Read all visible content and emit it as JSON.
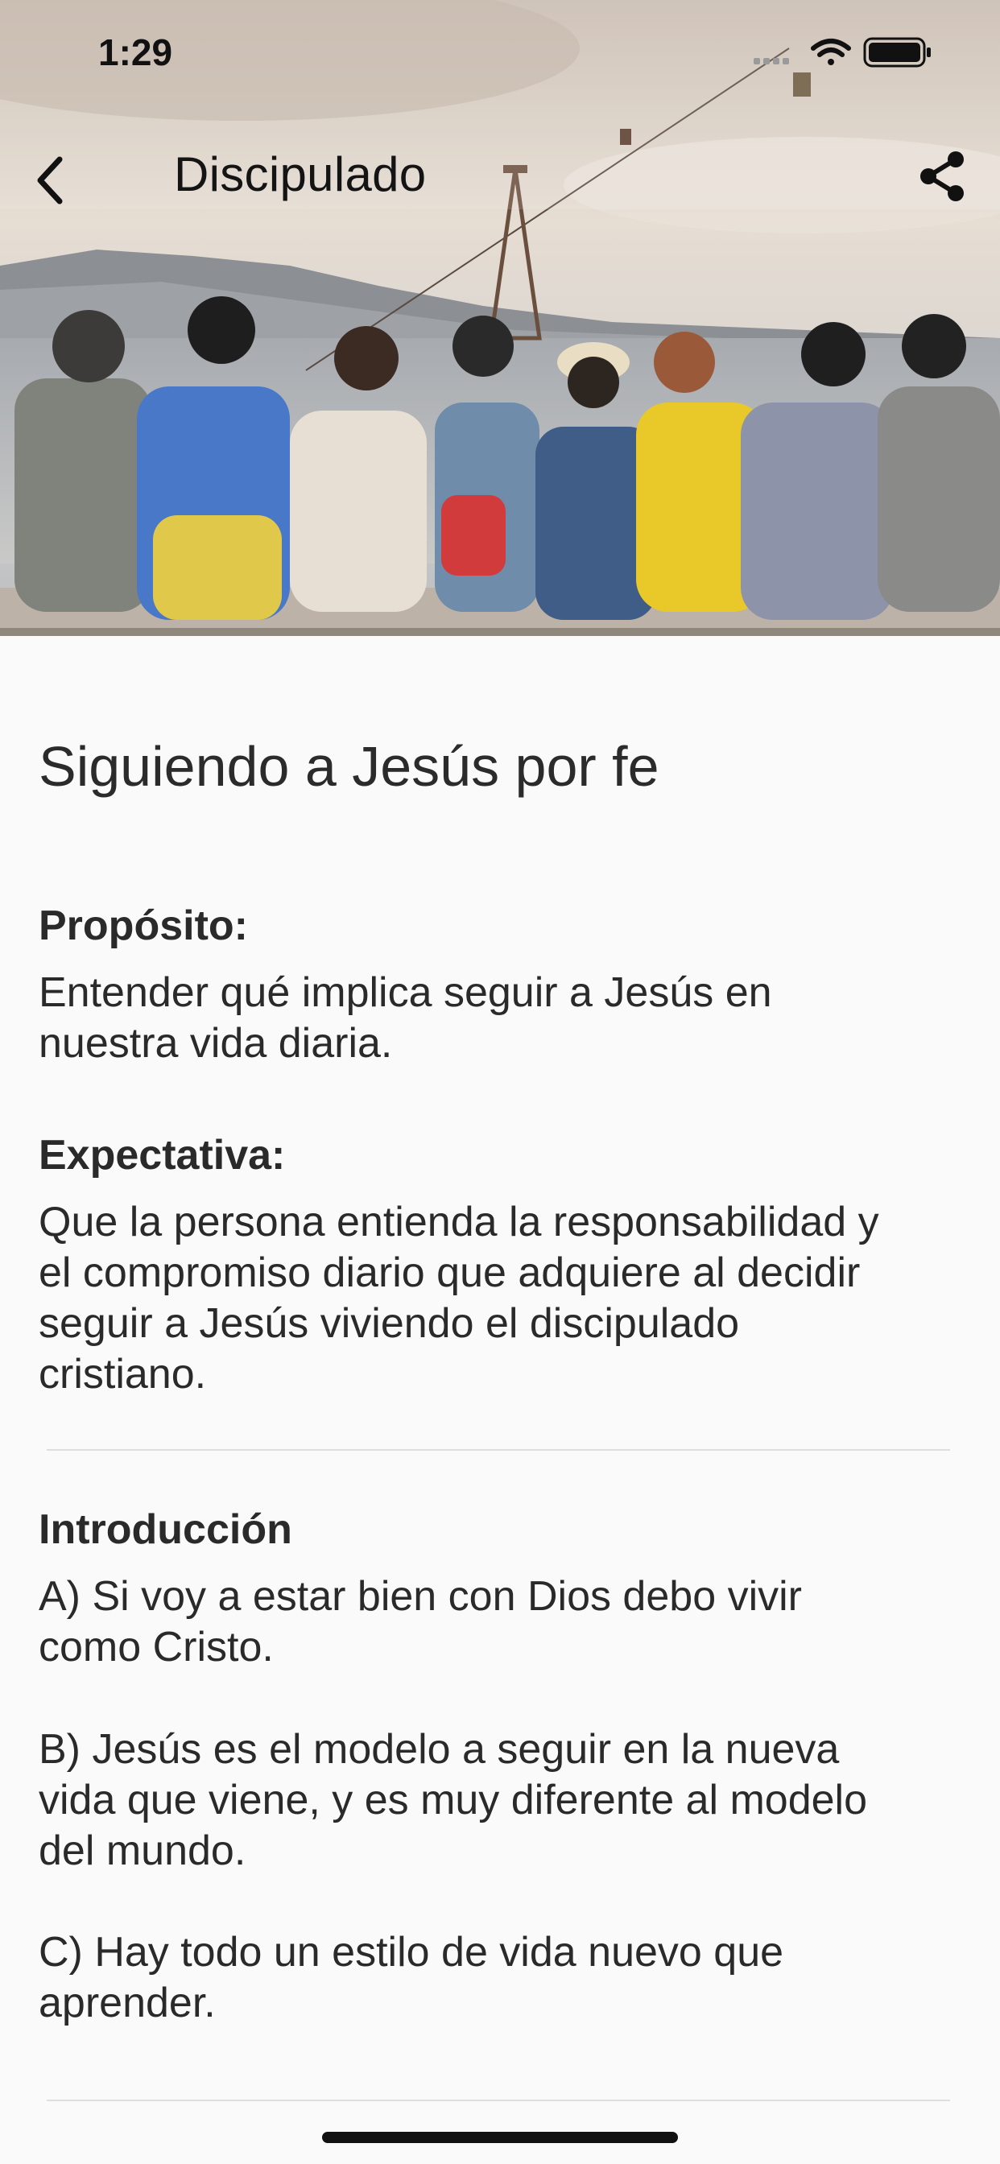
{
  "status_bar": {
    "time": "1:29",
    "icons": [
      "signal-icon",
      "wifi-icon",
      "battery-icon"
    ]
  },
  "nav": {
    "title": "Discipulado",
    "back_icon": "chevron-left-icon",
    "share_icon": "share-icon"
  },
  "hero_image": {
    "description_colors": [
      "#d8cbbd",
      "#8a8e94",
      "#3a3a3a"
    ]
  },
  "lesson": {
    "title": "Siguiendo a Jesús por fe",
    "purpose_label": "Propósito:",
    "purpose_lines": [
      "Entender qué implica seguir a Jesús en",
      "nuestra vida diaria."
    ],
    "expectation_label": "Expectativa:",
    "expectation_lines": [
      "Que la persona entienda la responsabilidad y",
      "el compromiso diario que adquiere al decidir",
      "seguir a Jesús viviendo el discipulado",
      "cristiano."
    ],
    "intro_label": "Introducción",
    "intro_a_lines": [
      "A) Si voy a estar bien con Dios debo vivir",
      "como Cristo."
    ],
    "intro_b_lines": [
      "B) Jesús es el modelo a seguir en la nueva",
      "vida que viene, y es muy diferente al modelo",
      "del mundo."
    ],
    "intro_c_lines": [
      "C) Hay todo un estilo de vida nuevo que",
      "aprender."
    ]
  },
  "colors": {
    "background": "#fafafa",
    "text": "#2a2a2a",
    "divider": "#dedede"
  }
}
